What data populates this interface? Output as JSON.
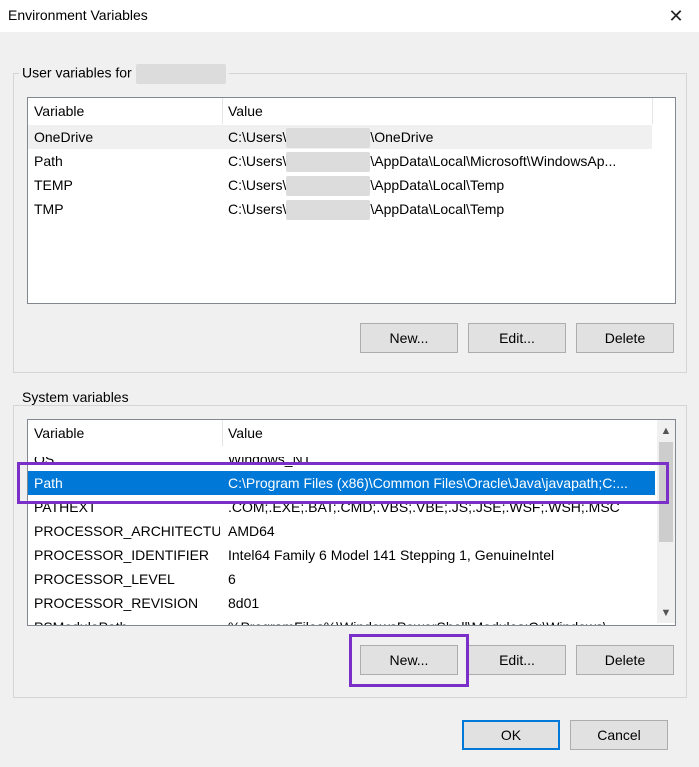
{
  "window": {
    "title": "Environment Variables",
    "close_glyph": "✕"
  },
  "user_group": {
    "label": "User variables for",
    "columns": [
      "Variable",
      "Value"
    ],
    "rows": [
      {
        "variable": "OneDrive",
        "value_prefix": "C:\\Users\\",
        "value_suffix": "\\OneDrive"
      },
      {
        "variable": "Path",
        "value_prefix": "C:\\Users\\",
        "value_suffix": "\\AppData\\Local\\Microsoft\\WindowsAp..."
      },
      {
        "variable": "TEMP",
        "value_prefix": "C:\\Users\\",
        "value_suffix": "\\AppData\\Local\\Temp"
      },
      {
        "variable": "TMP",
        "value_prefix": "C:\\Users\\",
        "value_suffix": "\\AppData\\Local\\Temp"
      }
    ],
    "buttons": {
      "new": "New...",
      "edit": "Edit...",
      "delete": "Delete"
    }
  },
  "system_group": {
    "label": "System variables",
    "columns": [
      "Variable",
      "Value"
    ],
    "rows": [
      {
        "variable": "OS",
        "value": "Windows_NT"
      },
      {
        "variable": "Path",
        "value": "C:\\Program Files (x86)\\Common Files\\Oracle\\Java\\javapath;C:..."
      },
      {
        "variable": "PATHEXT",
        "value": ".COM;.EXE;.BAT;.CMD;.VBS;.VBE;.JS;.JSE;.WSF;.WSH;.MSC"
      },
      {
        "variable": "PROCESSOR_ARCHITECTU...",
        "value": "AMD64"
      },
      {
        "variable": "PROCESSOR_IDENTIFIER",
        "value": "Intel64 Family 6 Model 141 Stepping 1, GenuineIntel"
      },
      {
        "variable": "PROCESSOR_LEVEL",
        "value": "6"
      },
      {
        "variable": "PROCESSOR_REVISION",
        "value": "8d01"
      },
      {
        "variable": "PSModulePath",
        "value": "%ProgramFiles%\\WindowsPowerShell\\Modules;C:\\Windows\\..."
      }
    ],
    "selected_variable": "Path",
    "buttons": {
      "new": "New...",
      "edit": "Edit...",
      "delete": "Delete"
    }
  },
  "footer": {
    "ok": "OK",
    "cancel": "Cancel"
  },
  "colors": {
    "selection": "#0078d7",
    "highlight": "#7b2fc9"
  }
}
